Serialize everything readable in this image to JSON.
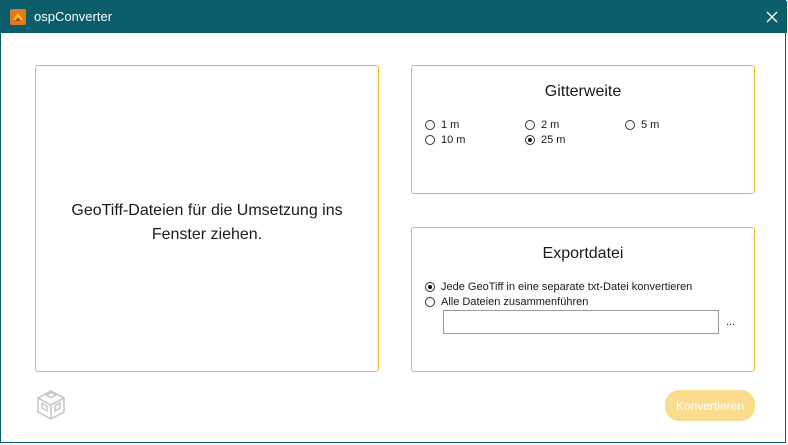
{
  "window": {
    "title": "ospConverter"
  },
  "drop_zone": {
    "text": "GeoTiff-Dateien für die Umsetzung ins Fenster ziehen."
  },
  "grid": {
    "title": "Gitterweite",
    "options": [
      "1 m",
      "2 m",
      "5 m",
      "10 m",
      "25 m"
    ],
    "selected": "25 m"
  },
  "export": {
    "title": "Exportdatei",
    "options": [
      "Jede GeoTiff in eine separate txt-Datei konvertieren",
      "Alle Dateien zusammenführen"
    ],
    "selected": "Jede GeoTiff in eine separate txt-Datei konvertieren",
    "path_value": "",
    "browse_label": "..."
  },
  "actions": {
    "convert_label": "Konvertieren",
    "convert_enabled": false
  },
  "colors": {
    "titlebar": "#0b5d6b",
    "panel_border": "#f0b928",
    "button_disabled": "#f9dc8d"
  },
  "icons": {
    "app": "osp-app-icon",
    "close": "close-icon",
    "logo": "osp-cube-logo"
  }
}
